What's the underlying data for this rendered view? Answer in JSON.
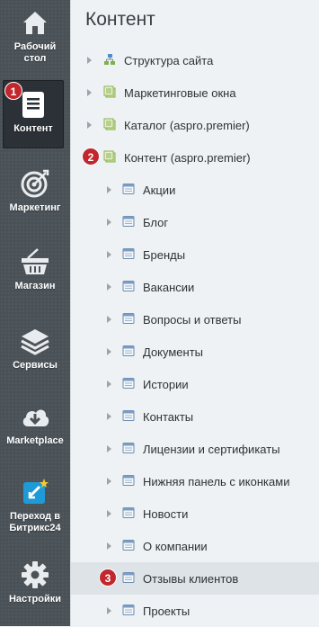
{
  "rail": {
    "items": [
      {
        "label1": "Рабочий",
        "label2": "стол",
        "icon": "home-icon"
      },
      {
        "label1": "Контент",
        "label2": "",
        "icon": "document-icon",
        "badge": "1"
      },
      {
        "label1": "Маркетинг",
        "label2": "",
        "icon": "target-icon"
      },
      {
        "label1": "Магазин",
        "label2": "",
        "icon": "basket-icon"
      },
      {
        "label1": "Сервисы",
        "label2": "",
        "icon": "layers-icon"
      },
      {
        "label1": "Marketplace",
        "label2": "",
        "icon": "cloud-download-icon"
      },
      {
        "label1": "Переход в",
        "label2": "Битрикс24",
        "icon": "bitrix24-icon"
      },
      {
        "label1": "Настройки",
        "label2": "",
        "icon": "gear-icon"
      }
    ]
  },
  "panel": {
    "title": "Контент",
    "top_items": [
      {
        "label": "Структура сайта",
        "icon": "site-structure-icon"
      },
      {
        "label": "Маркетинговые окна",
        "icon": "infoblock-icon"
      },
      {
        "label": "Каталог (aspro.premier)",
        "icon": "infoblock-icon"
      },
      {
        "label": "Контент (aspro.premier)",
        "icon": "infoblock-icon",
        "badge": "2"
      }
    ],
    "sub_items": [
      {
        "label": "Акции"
      },
      {
        "label": "Блог"
      },
      {
        "label": "Бренды"
      },
      {
        "label": "Вакансии"
      },
      {
        "label": "Вопросы и ответы"
      },
      {
        "label": "Документы"
      },
      {
        "label": "Истории"
      },
      {
        "label": "Контакты"
      },
      {
        "label": "Лицензии и сертификаты"
      },
      {
        "label": "Нижняя панель с иконками"
      },
      {
        "label": "Новости"
      },
      {
        "label": "О компании"
      },
      {
        "label": "Отзывы клиентов",
        "badge": "3",
        "highlighted": true
      },
      {
        "label": "Проекты"
      }
    ]
  },
  "colors": {
    "rail_bg": "#4a5258",
    "badge": "#c1272d",
    "panel_bg": "#eef2f4",
    "highlight": "#dde3e7"
  }
}
